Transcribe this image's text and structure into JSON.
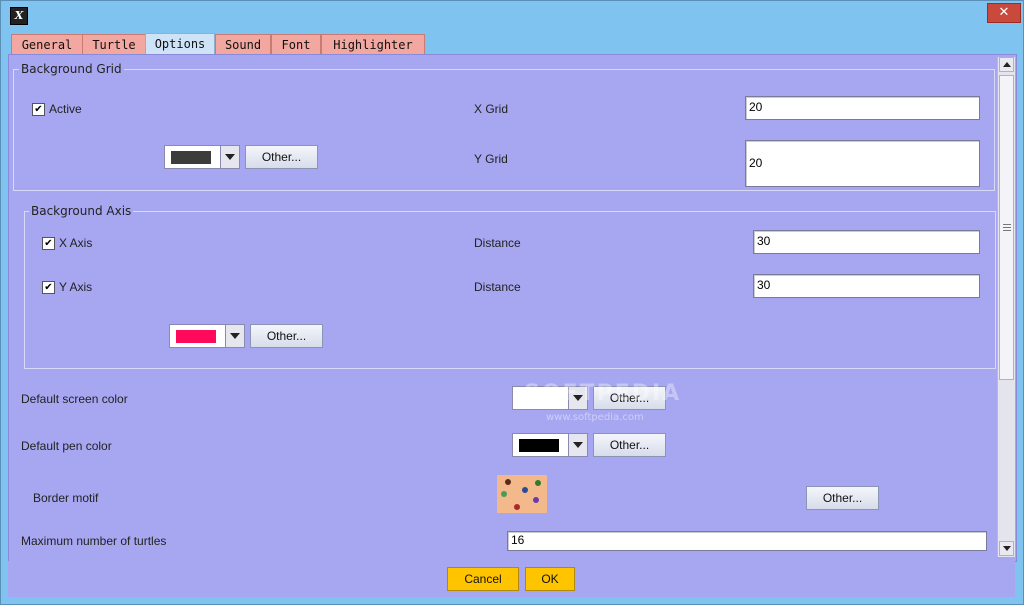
{
  "window": {
    "app_icon": "X",
    "close_label": "✕"
  },
  "tabs": [
    {
      "label": "General"
    },
    {
      "label": "Turtle"
    },
    {
      "label": "Options",
      "active": true
    },
    {
      "label": "Sound"
    },
    {
      "label": "Font"
    },
    {
      "label": "Highlighter"
    }
  ],
  "grid": {
    "title": "Background Grid",
    "active_label": "Active",
    "active_checked": true,
    "x_label": "X Grid",
    "x_value": "20",
    "y_label": "Y Grid",
    "y_value": "20",
    "color": "#3c3c3c",
    "other_label": "Other..."
  },
  "axis": {
    "title": "Background Axis",
    "x_label": "X Axis",
    "x_checked": true,
    "x_distance_label": "Distance",
    "x_distance": "30",
    "y_label": "Y Axis",
    "y_checked": true,
    "y_distance_label": "Distance",
    "y_distance": "30",
    "color": "#ff0a5a",
    "other_label": "Other..."
  },
  "screen_color": {
    "label": "Default screen color",
    "color": "#ffffff",
    "other_label": "Other..."
  },
  "pen_color": {
    "label": "Default pen color",
    "color": "#000000",
    "other_label": "Other..."
  },
  "border_motif": {
    "label": "Border motif",
    "other_label": "Other..."
  },
  "max_turtles": {
    "label": "Maximum number of turtles",
    "value": "16"
  },
  "watermark": {
    "logo": "SOFTPEDIA",
    "url": "www.softpedia.com"
  },
  "footer": {
    "cancel_label": "Cancel",
    "ok_label": "OK"
  },
  "colors": {
    "window_frame": "#7fc3f0",
    "panel": "#a7a6f1",
    "tab": "#f2a7a0",
    "tab_active": "#cfe3f7",
    "button_yellow": "#ffc400"
  }
}
